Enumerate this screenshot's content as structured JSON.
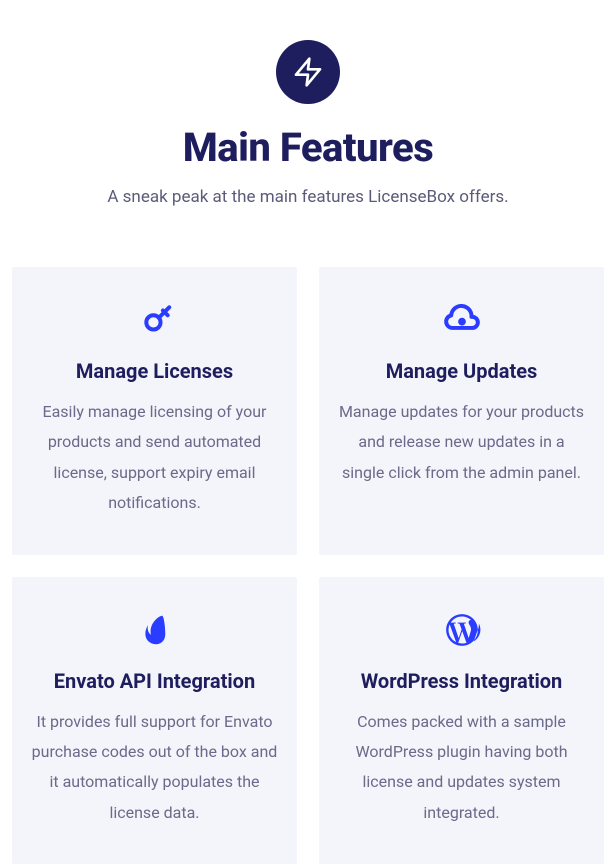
{
  "header": {
    "title": "Main Features",
    "subtitle": "A sneak peak at the main features LicenseBox offers."
  },
  "features": [
    {
      "icon": "key-icon",
      "title": "Manage Licenses",
      "description": "Easily manage licensing of your products and send automated license, support expiry email notifications."
    },
    {
      "icon": "cloud-download-icon",
      "title": "Manage Updates",
      "description": "Manage updates for your products and release new updates in a single click from the admin panel."
    },
    {
      "icon": "envato-icon",
      "title": "Envato API Integration",
      "description": "It provides full support for Envato purchase codes out of the box and it automatically populates the license data."
    },
    {
      "icon": "wordpress-icon",
      "title": "WordPress Integration",
      "description": "Comes packed with a sample WordPress plugin having both license and updates system integrated."
    }
  ],
  "colors": {
    "primary": "#1e1e5e",
    "accent": "#2a3cff",
    "text": "#6a6a8a",
    "cardBg": "#f4f4fb"
  }
}
